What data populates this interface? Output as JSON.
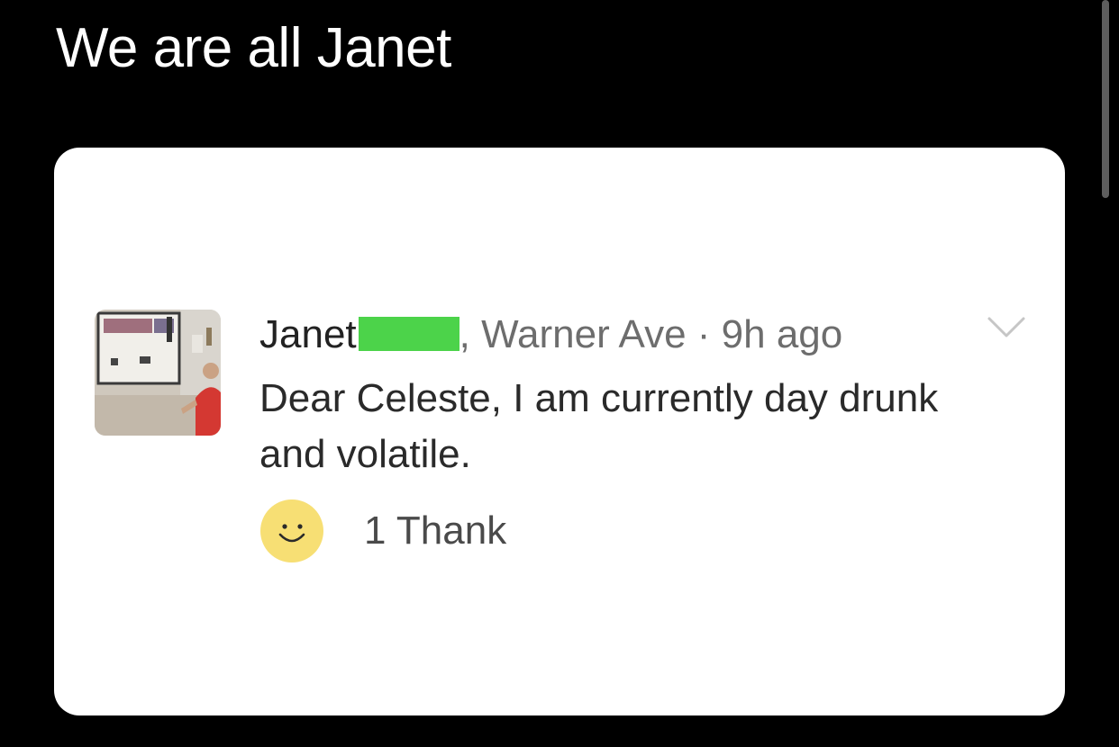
{
  "caption": "We are all Janet",
  "post": {
    "author": "Janet",
    "redaction_color": "#4cd34a",
    "separator": ",",
    "location": "Warner Ave",
    "dot": "·",
    "time": "9h ago",
    "body": "Dear Celeste, I am currently day drunk and volatile.",
    "reaction_icon": "smiley-face-icon",
    "reaction_color": "#f7df74",
    "thanks": "1 Thank"
  }
}
